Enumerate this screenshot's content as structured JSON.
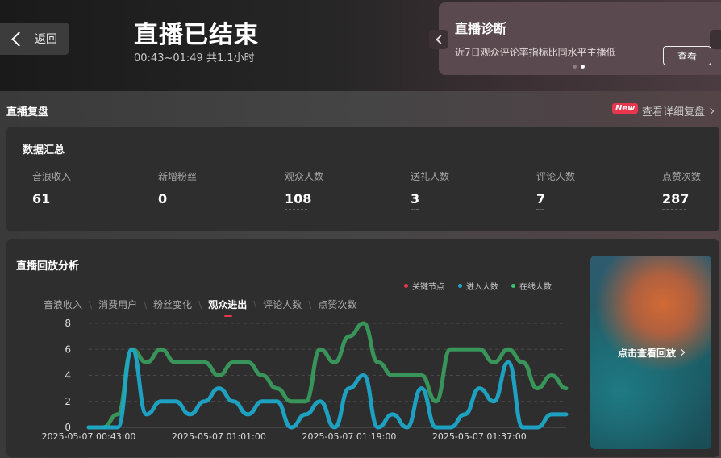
{
  "header": {
    "back_label": "返回",
    "title": "直播已结束",
    "subtitle": "00:43~01:49 共1.1小时"
  },
  "diagnosis": {
    "title": "直播诊断",
    "description": "近7日观众评论率指标比同水平主播低",
    "button": "查看"
  },
  "review": {
    "section_title": "直播复盘",
    "badge": "New",
    "detail_link": "查看详细复盘"
  },
  "summary": {
    "title": "数据汇总",
    "metrics": [
      {
        "label": "音浪收入",
        "value": "61"
      },
      {
        "label": "新增粉丝",
        "value": "0"
      },
      {
        "label": "观众人数",
        "value": "108"
      },
      {
        "label": "送礼人数",
        "value": "3"
      },
      {
        "label": "评论人数",
        "value": "7"
      },
      {
        "label": "点赞次数",
        "value": "287"
      }
    ]
  },
  "analysis": {
    "title": "直播回放分析",
    "legend": [
      {
        "label": "关键节点",
        "color": "#e8364f"
      },
      {
        "label": "进入人数",
        "color": "#1ea8c8"
      },
      {
        "label": "在线人数",
        "color": "#37c46a"
      }
    ],
    "tabs": [
      "音浪收入",
      "消费用户",
      "粉丝变化",
      "观众进出",
      "评论人数",
      "点赞次数"
    ],
    "active_tab": 3,
    "replay_label": "点击查看回放"
  },
  "chart_data": {
    "type": "line",
    "x": [
      "00:43",
      "00:45",
      "00:47",
      "00:49",
      "00:51",
      "00:53",
      "00:55",
      "00:57",
      "00:59",
      "01:01",
      "01:03",
      "01:05",
      "01:07",
      "01:09",
      "01:11",
      "01:13",
      "01:15",
      "01:17",
      "01:19",
      "01:21",
      "01:23",
      "01:25",
      "01:27",
      "01:29",
      "01:31",
      "01:33",
      "01:35",
      "01:37",
      "01:39",
      "01:41",
      "01:43",
      "01:45",
      "01:47",
      "01:49"
    ],
    "x_tick_labels": [
      "2025-05-07 00:43:00",
      "2025-05-07 01:01:00",
      "2025-05-07 01:19:00",
      "2025-05-07 01:37:00"
    ],
    "series": [
      {
        "name": "在线人数",
        "color": "#3a9a5c",
        "values": [
          0,
          0,
          1,
          6,
          5,
          6,
          5,
          5,
          5,
          4,
          5,
          5,
          4,
          3,
          2,
          2,
          6,
          5,
          7,
          8,
          5,
          4,
          4,
          4,
          2,
          6,
          6,
          6,
          5,
          6,
          5,
          3,
          4,
          3
        ]
      },
      {
        "name": "进入人数",
        "color": "#1ea8c8",
        "values": [
          0,
          0,
          0,
          6,
          1,
          2,
          2,
          1,
          2,
          3,
          2,
          1,
          2,
          2,
          0,
          1,
          2,
          0,
          3,
          4,
          0,
          1,
          0,
          3,
          0,
          0,
          1,
          3,
          2,
          5,
          0,
          0,
          1,
          1
        ]
      }
    ],
    "ylim": [
      0,
      8
    ],
    "y_ticks": [
      0,
      2,
      4,
      6,
      8
    ],
    "grid": true
  }
}
